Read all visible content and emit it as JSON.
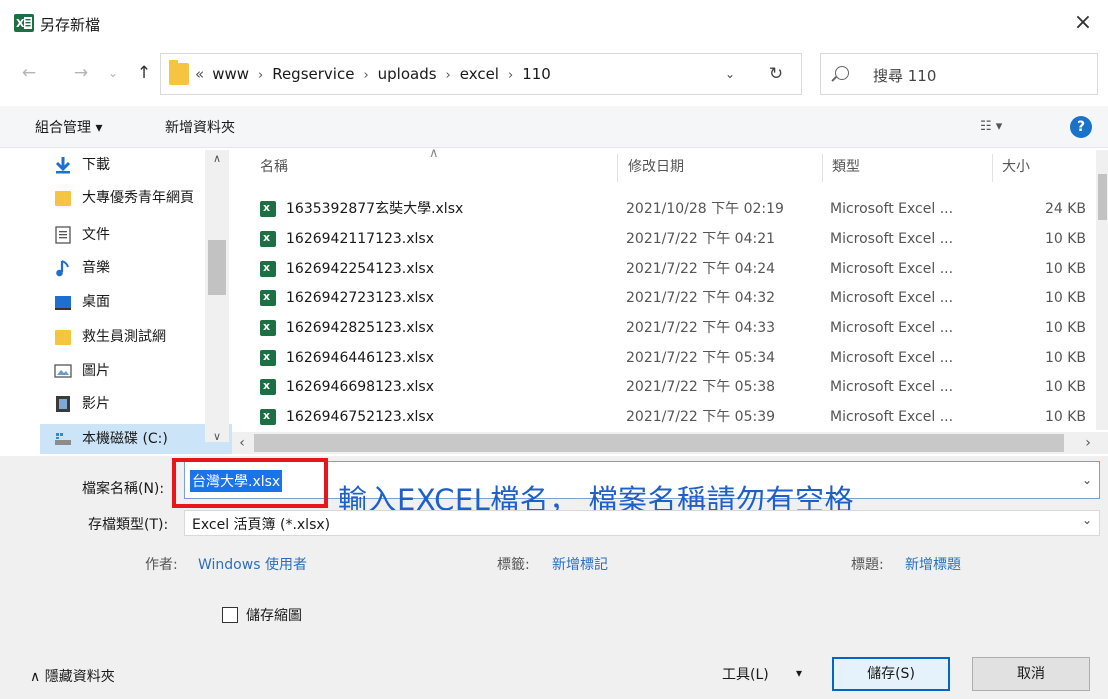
{
  "window": {
    "title": "另存新檔",
    "close_glyph": "×"
  },
  "navigation": {
    "back_glyph": "←",
    "forward_glyph": "→",
    "recent_glyph": "⌄",
    "up_glyph": "↑",
    "breadcrumb_prefix": "«",
    "breadcrumb": [
      "www",
      "Regservice",
      "uploads",
      "excel",
      "110"
    ],
    "separator_glyph": "›",
    "dropdown_glyph": "⌄",
    "refresh_glyph": "↻",
    "search_placeholder": "搜尋 110"
  },
  "toolbar": {
    "organize_label": "組合管理 ▾",
    "new_folder_label": "新增資料夾",
    "view_glyph": "☷ ▾",
    "help_glyph": "?"
  },
  "sidebar": {
    "items": [
      {
        "label": "下載",
        "icon": "download-icon",
        "color": "#1e6fd1"
      },
      {
        "label": "大專優秀青年網頁",
        "icon": "folder-icon",
        "color": "#f5c542"
      },
      {
        "label": "文件",
        "icon": "document-icon",
        "color": "#6b6b6b"
      },
      {
        "label": "音樂",
        "icon": "music-icon",
        "color": "#1e6fd1"
      },
      {
        "label": "桌面",
        "icon": "desktop-icon",
        "color": "#1e6fd1"
      },
      {
        "label": "救生員測試網",
        "icon": "folder-icon",
        "color": "#f5c542"
      },
      {
        "label": "圖片",
        "icon": "pictures-icon",
        "color": "#6b6b6b"
      },
      {
        "label": "影片",
        "icon": "video-icon",
        "color": "#555555"
      },
      {
        "label": "本機磁碟 (C:)",
        "icon": "drive-icon",
        "color": "#2e8bd6"
      }
    ],
    "selected_index": 8
  },
  "file_list": {
    "columns": [
      "名稱",
      "修改日期",
      "類型",
      "大小"
    ],
    "rows": [
      {
        "name": "1635392877玄奘大學.xlsx",
        "date": "2021/10/28 下午 02:19",
        "type": "Microsoft Excel ...",
        "size": "24 KB"
      },
      {
        "name": "1626942117123.xlsx",
        "date": "2021/7/22 下午 04:21",
        "type": "Microsoft Excel ...",
        "size": "10 KB"
      },
      {
        "name": "1626942254123.xlsx",
        "date": "2021/7/22 下午 04:24",
        "type": "Microsoft Excel ...",
        "size": "10 KB"
      },
      {
        "name": "1626942723123.xlsx",
        "date": "2021/7/22 下午 04:32",
        "type": "Microsoft Excel ...",
        "size": "10 KB"
      },
      {
        "name": "1626942825123.xlsx",
        "date": "2021/7/22 下午 04:33",
        "type": "Microsoft Excel ...",
        "size": "10 KB"
      },
      {
        "name": "1626946446123.xlsx",
        "date": "2021/7/22 下午 05:34",
        "type": "Microsoft Excel ...",
        "size": "10 KB"
      },
      {
        "name": "1626946698123.xlsx",
        "date": "2021/7/22 下午 05:38",
        "type": "Microsoft Excel ...",
        "size": "10 KB"
      },
      {
        "name": "1626946752123.xlsx",
        "date": "2021/7/22 下午 05:39",
        "type": "Microsoft Excel ...",
        "size": "10 KB"
      }
    ]
  },
  "save_form": {
    "filename_label": "檔案名稱(N):",
    "filename_value": "台灣大學.xlsx",
    "annotation_text": "輸入EXCEL檔名， 檔案名稱請勿有空格",
    "annotation_color": "#1f5fc8",
    "highlight_color": "#e8161a",
    "filetype_label": "存檔類型(T):",
    "filetype_value": "Excel 活頁簿 (*.xlsx)",
    "author_label": "作者:",
    "author_value": "Windows 使用者",
    "tags_label": "標籤:",
    "tags_value": "新增標記",
    "title_label": "標題:",
    "title_value": "新增標題",
    "thumbnail_label": "儲存縮圖",
    "thumbnail_checked": false
  },
  "footer": {
    "hide_folders_label": "∧  隱藏資料夾",
    "tools_label": "工具(L)",
    "tools_caret": "▾",
    "save_label": "儲存(S)",
    "cancel_label": "取消"
  }
}
